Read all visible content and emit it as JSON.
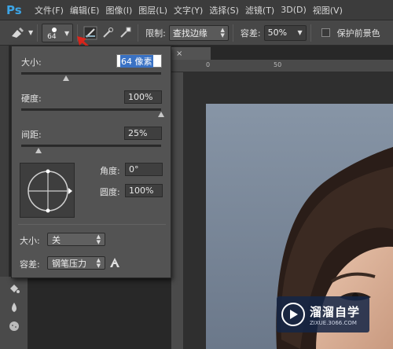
{
  "app": {
    "logo": "Ps"
  },
  "menu": [
    "文件(F)",
    "编辑(E)",
    "图像(I)",
    "图层(L)",
    "文字(Y)",
    "选择(S)",
    "滤镜(T)",
    "3D(D)",
    "视图(V)"
  ],
  "options_bar": {
    "brush_size": "64",
    "limit_label": "限制:",
    "limit_value": "查找边缘",
    "tolerance_label": "容差:",
    "tolerance_value": "50%",
    "protect_fg_label": "保护前景色",
    "protect_fg_checked": false
  },
  "doc_tab": {
    "close": "×"
  },
  "ruler": {
    "top_labels": [
      "0",
      "50"
    ]
  },
  "brush_panel": {
    "size_label": "大小:",
    "size_value": "64 像素",
    "size_slider": 0.3,
    "hardness_label": "硬度:",
    "hardness_value": "100%",
    "hardness_slider": 1.0,
    "spacing_label": "间距:",
    "spacing_value": "25%",
    "spacing_slider": 0.1,
    "angle_label": "角度:",
    "angle_value": "0°",
    "roundness_label": "圆度:",
    "roundness_value": "100%",
    "size_ctrl_label": "大小:",
    "size_ctrl_value": "关",
    "tolerance_label": "容差:",
    "tolerance_ctrl_value": "钢笔压力"
  },
  "watermark": {
    "title": "溜溜自学",
    "subtitle": "ZIXUE.3066.COM"
  },
  "colors": {
    "accent_blue": "#3da5e6",
    "arrow_red": "#d9261c",
    "panel_bg": "#535353"
  }
}
